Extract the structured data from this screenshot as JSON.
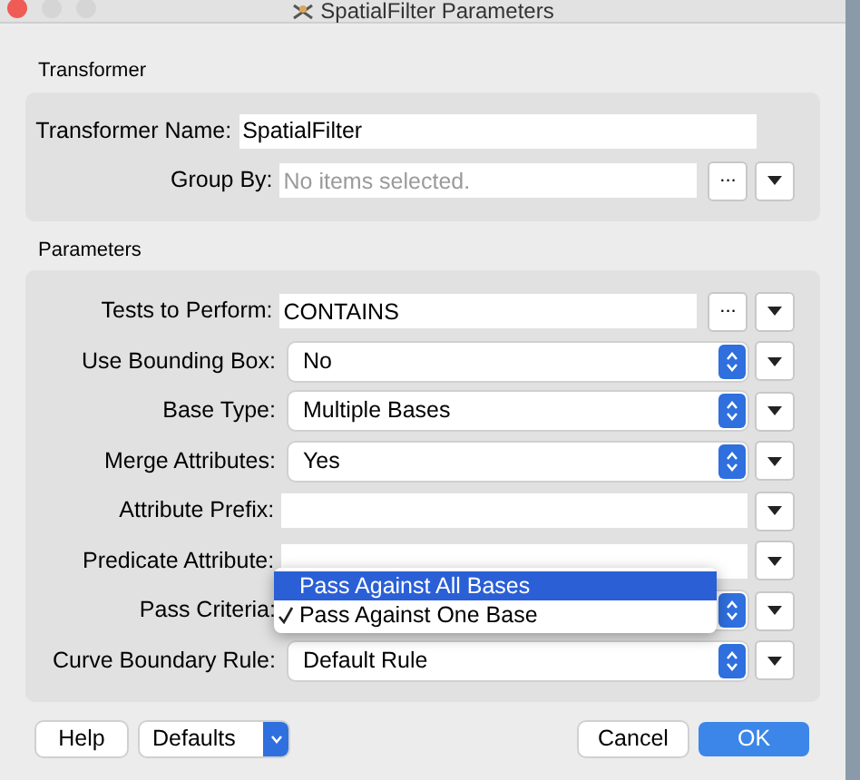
{
  "window": {
    "title": "SpatialFilter Parameters"
  },
  "sections": [
    {
      "title": "Transformer",
      "rows": [
        {
          "kind": "text",
          "label": "Transformer Name:",
          "value": "SpatialFilter",
          "menu": false
        },
        {
          "kind": "text",
          "label": "Group By:",
          "placeholder": "No items selected.",
          "browse": "...",
          "menu": true
        }
      ]
    },
    {
      "title": "Parameters",
      "rows": [
        {
          "kind": "text",
          "label": "Tests to Perform:",
          "value": "CONTAINS",
          "browse": "...",
          "menu": true
        },
        {
          "kind": "select",
          "label": "Use Bounding Box:",
          "value": "No",
          "menu": true
        },
        {
          "kind": "select",
          "label": "Base Type:",
          "value": "Multiple Bases",
          "menu": true
        },
        {
          "kind": "select",
          "label": "Merge Attributes:",
          "value": "Yes",
          "menu": true
        },
        {
          "kind": "text",
          "label": "Attribute Prefix:",
          "menu": true
        },
        {
          "kind": "text",
          "label": "Predicate Attribute:",
          "menu": true
        },
        {
          "kind": "popup",
          "label": "Pass Criteria:",
          "menu": true,
          "options": [
            {
              "label": "Pass Against All Bases",
              "selected": true,
              "checked": false
            },
            {
              "label": "Pass Against One Base",
              "selected": false,
              "checked": true
            }
          ]
        },
        {
          "kind": "select",
          "label": "Curve Boundary Rule:",
          "value": "Default Rule",
          "menu": true
        }
      ]
    }
  ],
  "buttons": {
    "help": "Help",
    "defaults": "Defaults",
    "cancel": "Cancel",
    "ok": "OK"
  }
}
